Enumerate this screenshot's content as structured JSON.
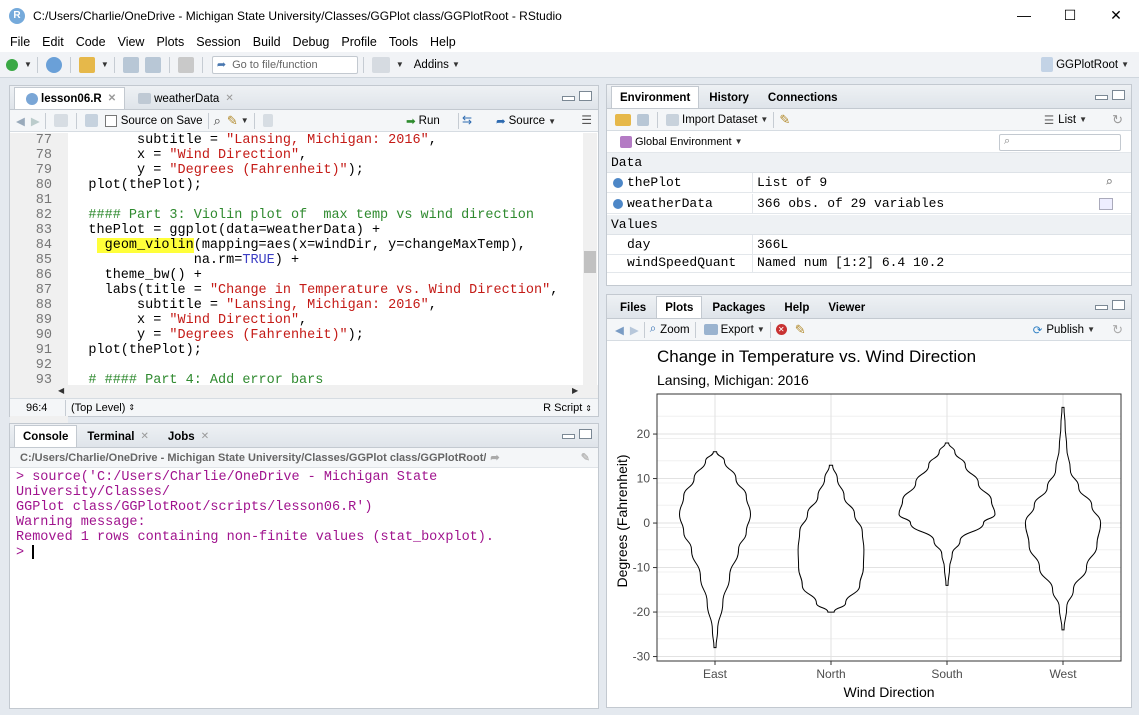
{
  "window": {
    "title": "C:/Users/Charlie/OneDrive - Michigan State University/Classes/GGPlot class/GGPlotRoot - RStudio",
    "app_icon": "R",
    "minimize": "—",
    "maximize": "☐",
    "close": "✕"
  },
  "menu": [
    "File",
    "Edit",
    "Code",
    "View",
    "Plots",
    "Session",
    "Build",
    "Debug",
    "Profile",
    "Tools",
    "Help"
  ],
  "toolbar": {
    "goto_placeholder": "Go to file/function",
    "addins": "Addins",
    "project": "GGPlotRoot"
  },
  "editor": {
    "tabs": [
      {
        "label": "lesson06.R"
      },
      {
        "label": "weatherData"
      }
    ],
    "source_on_save": "Source on Save",
    "run": "Run",
    "source": "Source",
    "status": {
      "position": "96:4",
      "scope": "(Top Level)",
      "type": "R Script"
    },
    "lines": [
      {
        "n": "77",
        "html": "        subtitle = <span class=\"cstr\">\"Lansing, Michigan: 2016\"</span>,"
      },
      {
        "n": "78",
        "html": "        x = <span class=\"cstr\">\"Wind Direction\"</span>,"
      },
      {
        "n": "79",
        "html": "        y = <span class=\"cstr\">\"Degrees (Fahrenheit)\"</span>);"
      },
      {
        "n": "80",
        "html": "  plot(thePlot);"
      },
      {
        "n": "81",
        "html": ""
      },
      {
        "n": "82",
        "html": "  <span class=\"ccom\">#### Part 3: Violin plot of  max temp vs wind direction</span>"
      },
      {
        "n": "83",
        "html": "  thePlot = ggplot(data=weatherData) +"
      },
      {
        "n": "84",
        "html": "   <span class=\"hl\"> geom_violin</span>(mapping=aes(x=windDir, y=changeMaxTemp),"
      },
      {
        "n": "85",
        "html": "               na.rm=<span class=\"ckw\">TRUE</span>) +"
      },
      {
        "n": "86",
        "html": "    theme_bw() +"
      },
      {
        "n": "87",
        "html": "    labs(title = <span class=\"cstr\">\"Change in Temperature vs. Wind Direction\"</span>,"
      },
      {
        "n": "88",
        "html": "        subtitle = <span class=\"cstr\">\"Lansing, Michigan: 2016\"</span>,"
      },
      {
        "n": "89",
        "html": "        x = <span class=\"cstr\">\"Wind Direction\"</span>,"
      },
      {
        "n": "90",
        "html": "        y = <span class=\"cstr\">\"Degrees (Fahrenheit)\"</span>);"
      },
      {
        "n": "91",
        "html": "  plot(thePlot);"
      },
      {
        "n": "92",
        "html": ""
      },
      {
        "n": "93",
        "html": "  <span class=\"ccom\"># #### Part 4: Add error bars</span>"
      },
      {
        "n": "94",
        "html": ""
      }
    ]
  },
  "console": {
    "tabs": [
      {
        "label": "Console"
      },
      {
        "label": "Terminal"
      },
      {
        "label": "Jobs"
      }
    ],
    "path": "C:/Users/Charlie/OneDrive - Michigan State University/Classes/GGPlot class/GGPlotRoot/",
    "lines": [
      "> source('C:/Users/Charlie/OneDrive - Michigan State University/Classes/",
      "GGPlot class/GGPlotRoot/scripts/lesson06.R')",
      "Warning message:",
      "Removed 1 rows containing non-finite values (stat_boxplot).",
      ">"
    ]
  },
  "environment": {
    "tabs": [
      {
        "label": "Environment"
      },
      {
        "label": "History"
      },
      {
        "label": "Connections"
      }
    ],
    "import_dataset": "Import Dataset",
    "list_view": "List",
    "scope": "Global Environment",
    "sections": {
      "data": "Data",
      "values": "Values"
    },
    "data_rows": [
      {
        "name": "thePlot",
        "value": "List of 9"
      },
      {
        "name": "weatherData",
        "value": "366 obs. of 29 variables"
      }
    ],
    "value_rows": [
      {
        "name": "day",
        "value": "366L"
      },
      {
        "name": "windSpeedQuant",
        "value": "Named num [1:2] 6.4 10.2"
      }
    ]
  },
  "files": {
    "tabs": [
      {
        "label": "Files"
      },
      {
        "label": "Plots"
      },
      {
        "label": "Packages"
      },
      {
        "label": "Help"
      },
      {
        "label": "Viewer"
      }
    ],
    "zoom": "Zoom",
    "export": "Export",
    "publish": "Publish"
  },
  "chart_data": {
    "type": "violin",
    "title": "Change in Temperature vs. Wind Direction",
    "subtitle": "Lansing, Michigan: 2016",
    "xlabel": "Wind Direction",
    "ylabel": "Degrees (Fahrenheit)",
    "categories": [
      "East",
      "North",
      "South",
      "West"
    ],
    "ylim": [
      -31,
      29
    ],
    "yticks": [
      20,
      10,
      0,
      -10,
      -20,
      -30
    ],
    "grid": true,
    "violins": [
      {
        "category": "East",
        "min": -28,
        "max": 16,
        "profile": [
          [
            -28,
            0.02
          ],
          [
            -24,
            0.05
          ],
          [
            -18,
            0.15
          ],
          [
            -12,
            0.28
          ],
          [
            -6,
            0.45
          ],
          [
            -2,
            0.6
          ],
          [
            2,
            0.68
          ],
          [
            6,
            0.6
          ],
          [
            10,
            0.4
          ],
          [
            14,
            0.18
          ],
          [
            16,
            0.03
          ]
        ]
      },
      {
        "category": "North",
        "min": -20,
        "max": 13,
        "profile": [
          [
            -20,
            0.06
          ],
          [
            -18,
            0.28
          ],
          [
            -14,
            0.55
          ],
          [
            -10,
            0.62
          ],
          [
            -6,
            0.63
          ],
          [
            -2,
            0.6
          ],
          [
            2,
            0.45
          ],
          [
            6,
            0.25
          ],
          [
            10,
            0.12
          ],
          [
            13,
            0.03
          ]
        ]
      },
      {
        "category": "South",
        "min": -14,
        "max": 18,
        "profile": [
          [
            -14,
            0.02
          ],
          [
            -10,
            0.05
          ],
          [
            -7,
            0.1
          ],
          [
            -4,
            0.25
          ],
          [
            0,
            0.7
          ],
          [
            2,
            0.92
          ],
          [
            5,
            0.85
          ],
          [
            9,
            0.6
          ],
          [
            13,
            0.35
          ],
          [
            16,
            0.15
          ],
          [
            18,
            0.03
          ]
        ]
      },
      {
        "category": "West",
        "min": -24,
        "max": 26,
        "profile": [
          [
            -24,
            0.02
          ],
          [
            -19,
            0.07
          ],
          [
            -15,
            0.2
          ],
          [
            -10,
            0.45
          ],
          [
            -5,
            0.65
          ],
          [
            0,
            0.72
          ],
          [
            4,
            0.55
          ],
          [
            8,
            0.3
          ],
          [
            12,
            0.14
          ],
          [
            17,
            0.07
          ],
          [
            22,
            0.04
          ],
          [
            26,
            0.02
          ]
        ]
      }
    ]
  }
}
